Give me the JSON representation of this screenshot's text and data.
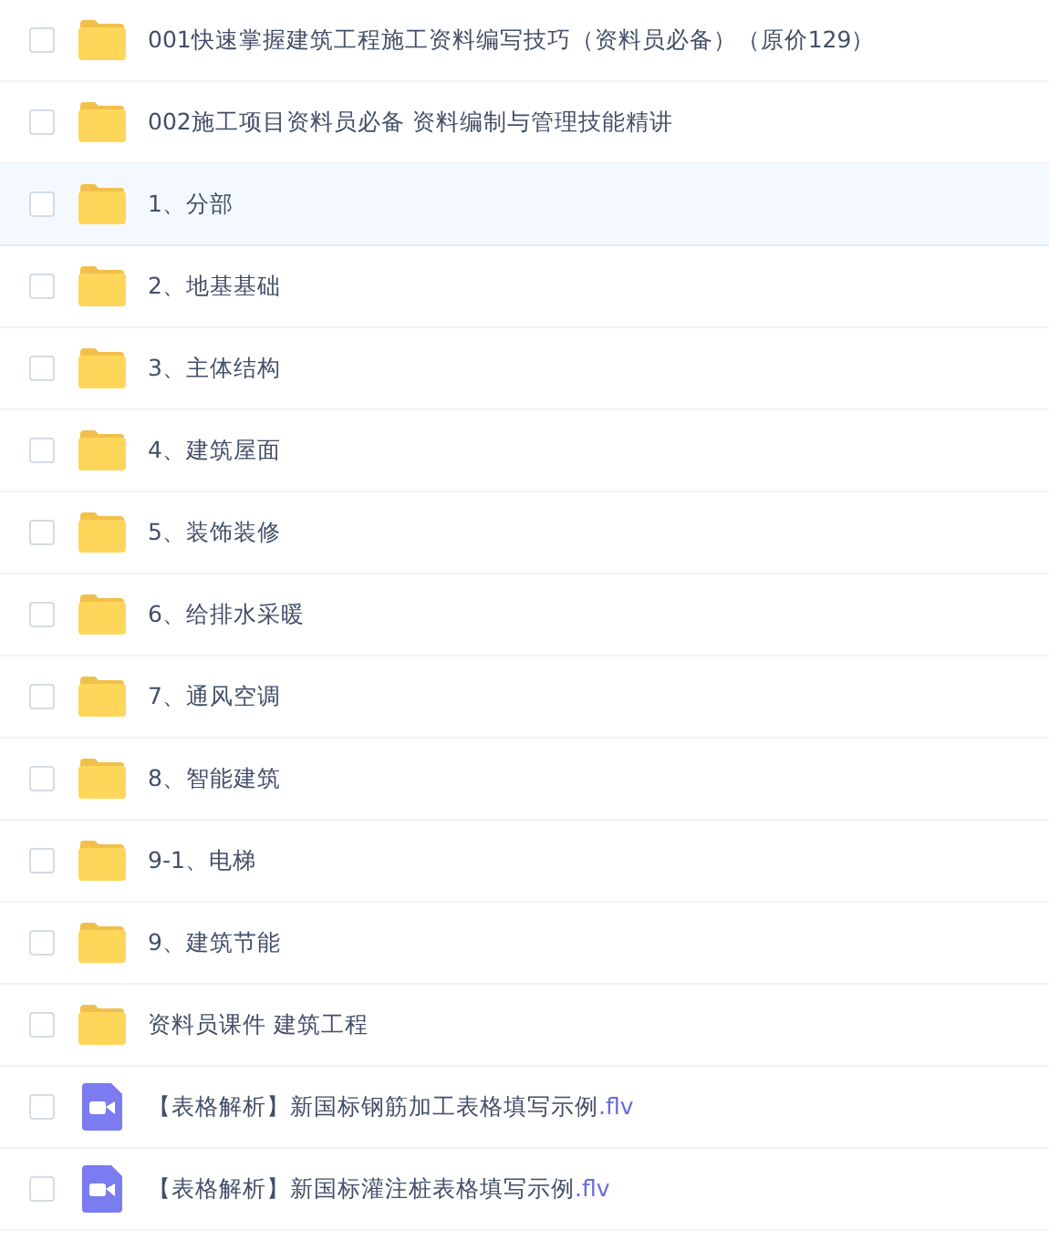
{
  "files": [
    {
      "kind": "folder",
      "name": "001快速掌握建筑工程施工资料编写技巧（资料员必备）（原价129）",
      "selected": false,
      "checked": false
    },
    {
      "kind": "folder",
      "name": "002施工项目资料员必备 资料编制与管理技能精讲",
      "selected": false,
      "checked": false
    },
    {
      "kind": "folder",
      "name": "1、分部",
      "selected": true,
      "checked": false
    },
    {
      "kind": "folder",
      "name": "2、地基基础",
      "selected": false,
      "checked": false
    },
    {
      "kind": "folder",
      "name": "3、主体结构",
      "selected": false,
      "checked": false
    },
    {
      "kind": "folder",
      "name": "4、建筑屋面",
      "selected": false,
      "checked": false
    },
    {
      "kind": "folder",
      "name": "5、装饰装修",
      "selected": false,
      "checked": false
    },
    {
      "kind": "folder",
      "name": "6、给排水采暖",
      "selected": false,
      "checked": false
    },
    {
      "kind": "folder",
      "name": "7、通风空调",
      "selected": false,
      "checked": false
    },
    {
      "kind": "folder",
      "name": "8、智能建筑",
      "selected": false,
      "checked": false
    },
    {
      "kind": "folder",
      "name": "9-1、电梯",
      "selected": false,
      "checked": false
    },
    {
      "kind": "folder",
      "name": "9、建筑节能",
      "selected": false,
      "checked": false
    },
    {
      "kind": "folder",
      "name": "资料员课件 建筑工程",
      "selected": false,
      "checked": false
    },
    {
      "kind": "video",
      "name": "【表格解析】新国标钢筋加工表格填写示例",
      "extension": ".flv",
      "selected": false,
      "checked": false
    },
    {
      "kind": "video",
      "name": "【表格解析】新国标灌注桩表格填写示例",
      "extension": ".flv",
      "selected": false,
      "checked": false
    }
  ]
}
